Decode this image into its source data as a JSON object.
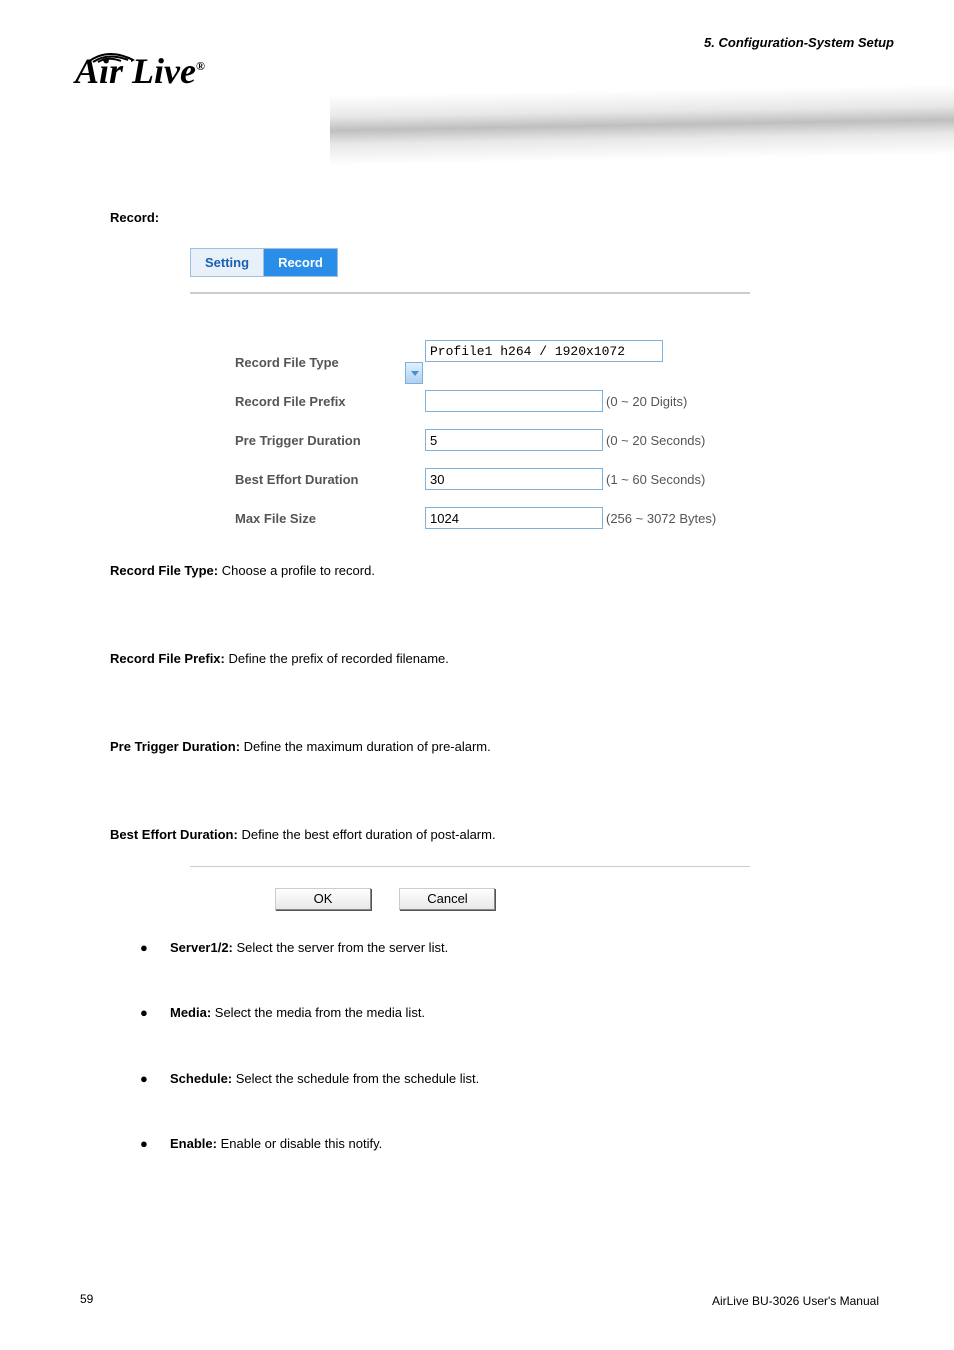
{
  "header": {
    "chapter_line1": "5. Configuration-System Setup",
    "chapter_line2": ""
  },
  "section_title": "Record:",
  "tabs": {
    "setting": "Setting",
    "record": "Record"
  },
  "form": {
    "record_file_type": {
      "label": "Record File Type",
      "value": "Profile1 h264 / 1920x1072"
    },
    "record_file_prefix": {
      "label": "Record File Prefix",
      "value": "",
      "hint": "(0 ~ 20 Digits)"
    },
    "pre_trigger_duration": {
      "label": "Pre Trigger Duration",
      "value": "5",
      "hint": "(0 ~ 20 Seconds)"
    },
    "best_effort_duration": {
      "label": "Best Effort Duration",
      "value": "30",
      "hint": "(1 ~ 60 Seconds)"
    },
    "max_file_size": {
      "label": "Max File Size",
      "value": "1024",
      "hint": "(256 ~ 3072 Bytes)"
    }
  },
  "descriptions": {
    "d1_label": "Record File Type:",
    "d1_text": " Choose a profile to record.",
    "d2_label": "Record File Prefix:",
    "d2_text": " Define the prefix of recorded filename.",
    "d3_label": "Pre Trigger Duration:",
    "d3_text": " Define the maximum duration of pre-alarm.",
    "d4_label": "Best Effort Duration:",
    "d4_text": " Define the best effort duration of post-alarm."
  },
  "buttons": {
    "ok": "OK",
    "cancel": "Cancel"
  },
  "bullets": [
    {
      "label": "Server1/2:",
      "text": " Select the server from the server list."
    },
    {
      "label": "Media:",
      "text": " Select the media from the media list."
    },
    {
      "label": "Schedule:",
      "text": " Select the schedule from the schedule list."
    },
    {
      "label": "Enable:",
      "text": " Enable or disable this notify."
    }
  ],
  "footer": {
    "page": "59",
    "line1": "AirLive BU-3026 User's Manual",
    "line2": ""
  }
}
